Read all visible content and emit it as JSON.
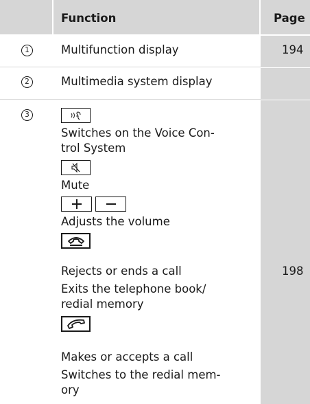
{
  "header": {
    "function": "Function",
    "page": "Page"
  },
  "rows": [
    {
      "num": "1",
      "text": "Multifunction display",
      "page": "194"
    },
    {
      "num": "2",
      "text": "Multimedia system display",
      "page": ""
    },
    {
      "num": "3",
      "page": "198",
      "lines": {
        "voice_1": "Switches on the Voice Con-",
        "voice_2": "trol System",
        "mute": "Mute",
        "volume": "Adjusts the volume",
        "reject": "Rejects or ends a call",
        "exit_1": "Exits the telephone book/",
        "exit_2": "redial memory",
        "accept": "Makes or accepts a call",
        "redial_1": "Switches to the redial mem-",
        "redial_2": "ory"
      }
    }
  ],
  "icons": [
    "voice-control-icon",
    "mute-icon",
    "plus-icon",
    "minus-icon",
    "hang-up-icon",
    "phone-accept-icon"
  ],
  "colors": {
    "header_bg": "#d6d6d6",
    "page_col_bg": "#d6d6d6",
    "text": "#1a1a1a",
    "divider": "#ffffff"
  }
}
